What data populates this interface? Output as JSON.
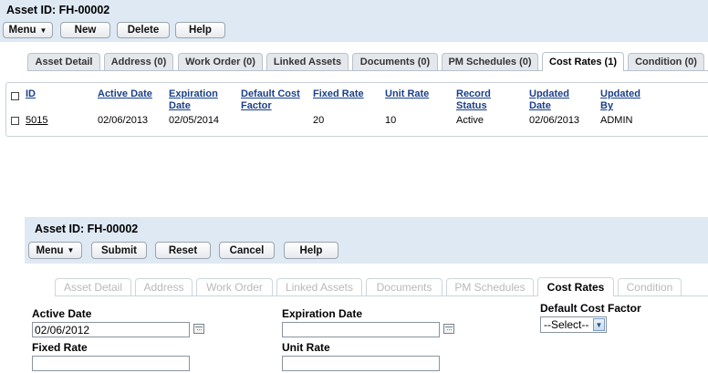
{
  "top": {
    "title": "Asset ID: FH-00002",
    "buttons": {
      "menu": "Menu",
      "new": "New",
      "delete": "Delete",
      "help": "Help"
    },
    "tabs": [
      "Asset Detail",
      "Address (0)",
      "Work Order (0)",
      "Linked Assets",
      "Documents (0)",
      "PM Schedules (0)",
      "Cost Rates (1)",
      "Condition (0)"
    ],
    "grid": {
      "headers": {
        "id": "ID",
        "active_date": "Active Date",
        "expiration_date_1": "Expiration",
        "expiration_date_2": "Date",
        "default_cost_factor_1": "Default Cost",
        "default_cost_factor_2": "Factor",
        "fixed_rate": "Fixed Rate",
        "unit_rate": "Unit Rate",
        "record_status_1": "Record",
        "record_status_2": "Status",
        "updated_date_1": "Updated",
        "updated_date_2": "Date",
        "updated_by_1": "Updated",
        "updated_by_2": "By"
      },
      "row": {
        "id": "5015",
        "active_date": "02/06/2013",
        "expiration_date": "02/05/2014",
        "default_cost_factor": "",
        "fixed_rate": "20",
        "unit_rate": "10",
        "record_status": "Active",
        "updated_date": "02/06/2013",
        "updated_by": "ADMIN"
      }
    }
  },
  "bottom": {
    "title": "Asset ID: FH-00002",
    "buttons": {
      "menu": "Menu",
      "submit": "Submit",
      "reset": "Reset",
      "cancel": "Cancel",
      "help": "Help"
    },
    "tabs": [
      "Asset Detail",
      "Address",
      "Work Order",
      "Linked Assets",
      "Documents",
      "PM Schedules",
      "Cost Rates",
      "Condition"
    ],
    "form": {
      "active_date_label": "Active Date",
      "active_date_value": "02/06/2012",
      "expiration_date_label": "Expiration Date",
      "expiration_date_value": "",
      "default_cost_factor_label": "Default Cost Factor",
      "default_cost_factor_selected": "--Select--",
      "fixed_rate_label": "Fixed Rate",
      "fixed_rate_value": "",
      "unit_rate_label": "Unit Rate",
      "unit_rate_value": ""
    }
  },
  "icons": {
    "menu_caret": "caret-down-icon",
    "calendar": "calendar-icon",
    "select_arrow": "chevron-down-icon"
  }
}
